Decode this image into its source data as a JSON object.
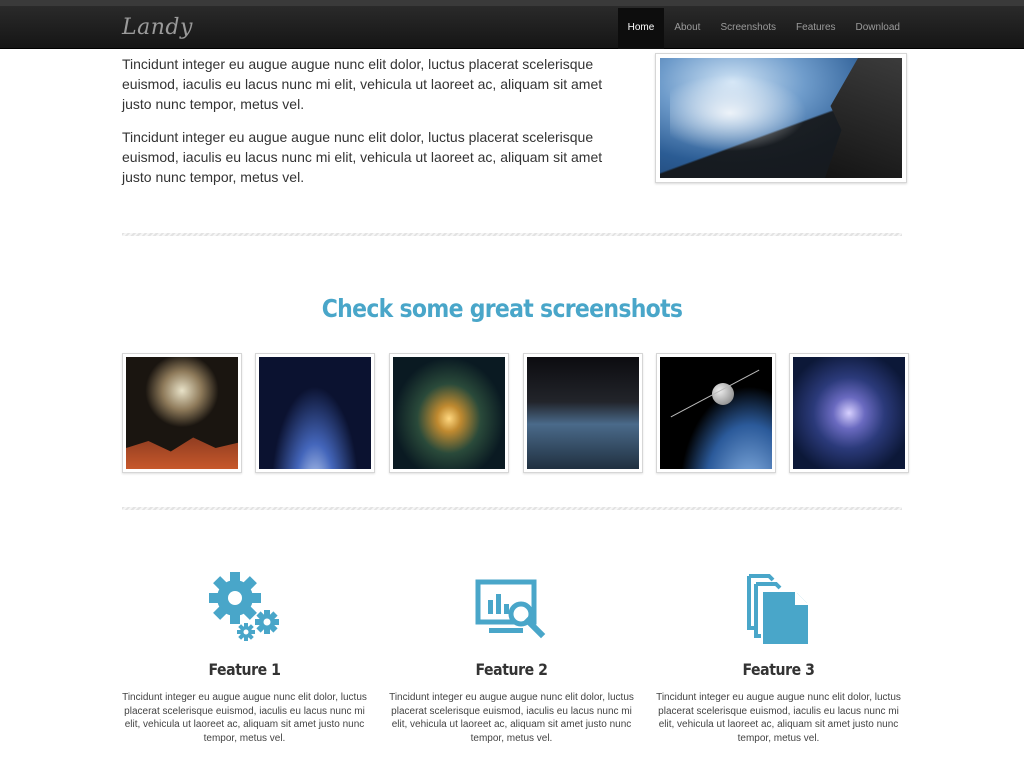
{
  "header": {
    "brand": "Landy",
    "nav": [
      {
        "label": "Home",
        "active": true
      },
      {
        "label": "About",
        "active": false
      },
      {
        "label": "Screenshots",
        "active": false
      },
      {
        "label": "Features",
        "active": false
      },
      {
        "label": "Download",
        "active": false
      }
    ]
  },
  "intro": {
    "paragraphs": [
      "Tincidunt integer eu augue augue nunc elit dolor, luctus placerat scelerisque euismod, iaculis eu lacus nunc mi elit, vehicula ut laoreet ac, aliquam sit amet justo nunc tempor, metus vel.",
      "Tincidunt integer eu augue augue nunc elit dolor, luctus placerat scelerisque euismod, iaculis eu lacus nunc mi elit, vehicula ut laoreet ac, aliquam sit amet justo nunc tempor, metus vel."
    ]
  },
  "screenshots": {
    "title": "Check some great screenshots"
  },
  "features": [
    {
      "title": "Feature 1",
      "icon": "gears-icon",
      "text": "Tincidunt integer eu augue augue nunc elit dolor, luctus placerat scelerisque euismod, iaculis eu lacus nunc mi elit, vehicula ut laoreet ac, aliquam sit amet justo nunc tempor, metus vel."
    },
    {
      "title": "Feature 2",
      "icon": "chart-search-icon",
      "text": "Tincidunt integer eu augue augue nunc elit dolor, luctus placerat scelerisque euismod, iaculis eu lacus nunc mi elit, vehicula ut laoreet ac, aliquam sit amet justo nunc tempor, metus vel."
    },
    {
      "title": "Feature 3",
      "icon": "documents-icon",
      "text": "Tincidunt integer eu augue augue nunc elit dolor, luctus placerat scelerisque euismod, iaculis eu lacus nunc mi elit, vehicula ut laoreet ac, aliquam sit amet justo nunc tempor, metus vel."
    }
  ],
  "colors": {
    "accent": "#49a6c9",
    "topbar": "#1c1c1c",
    "text": "#333333"
  }
}
